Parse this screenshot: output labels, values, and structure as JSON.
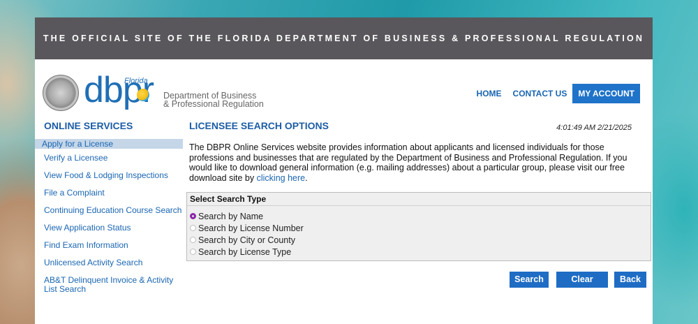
{
  "banner": {
    "text": "THE OFFICIAL SITE OF THE FLORIDA DEPARTMENT OF BUSINESS & PROFESSIONAL REGULATION"
  },
  "logo": {
    "florida": "Florida",
    "dbpr": "dbpr",
    "dept_line1": "Department of Business",
    "dept_line2": "& Professional Regulation"
  },
  "nav": {
    "home": "HOME",
    "contact": "CONTACT US",
    "account": "MY ACCOUNT"
  },
  "sidebar": {
    "title": "ONLINE SERVICES",
    "items": [
      {
        "label": "Apply for a License"
      },
      {
        "label": "Verify a Licensee"
      },
      {
        "label": "View Food & Lodging Inspections"
      },
      {
        "label": "File a Complaint"
      },
      {
        "label": "Continuing Education Course Search"
      },
      {
        "label": "View Application Status"
      },
      {
        "label": "Find Exam Information"
      },
      {
        "label": "Unlicensed Activity Search"
      },
      {
        "label": "AB&T Delinquent Invoice & Activity List Search"
      }
    ]
  },
  "main": {
    "title": "LICENSEE SEARCH OPTIONS",
    "timestamp": "4:01:49 AM 2/21/2025",
    "intro": "The DBPR Online Services website provides information about applicants and licensed individuals for those professions and businesses that are regulated by the Department of Business and Professional Regulation. If you would like to download general information (e.g. mailing addresses) about a particular group, please visit our free download site by",
    "intro_link": "clicking here",
    "intro_end": "."
  },
  "search_panel": {
    "header": "Select Search Type",
    "options": [
      {
        "label": "Search by Name",
        "selected": true
      },
      {
        "label": "Search by License Number",
        "selected": false
      },
      {
        "label": "Search by City or County",
        "selected": false
      },
      {
        "label": "Search by License Type",
        "selected": false
      }
    ]
  },
  "buttons": {
    "search": "Search",
    "clear": "Clear",
    "back": "Back"
  },
  "colors": {
    "accent": "#1f6cc4",
    "banner": "#59575b",
    "heading": "#1d5da6",
    "radio_selected": "#8b2aa5"
  }
}
